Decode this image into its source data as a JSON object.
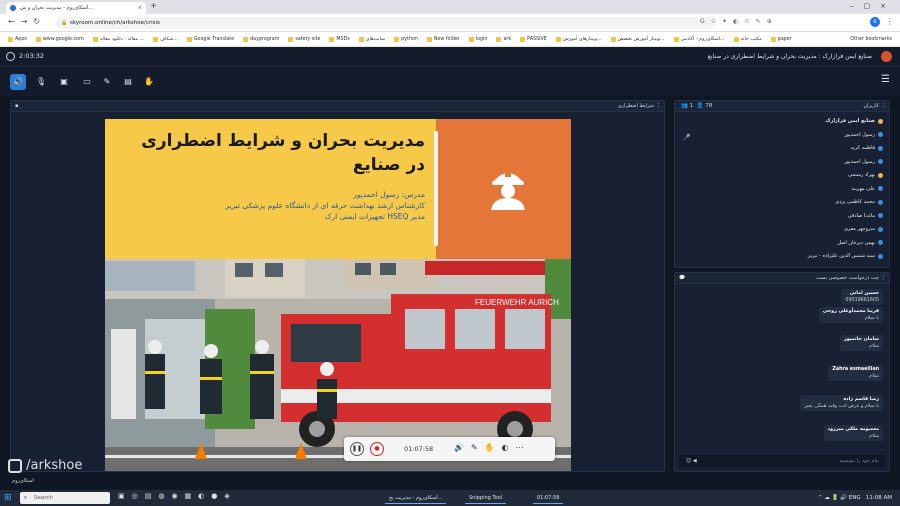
{
  "browser": {
    "tab_title": "اسکای‌روم - مدیریت بحران و ش...",
    "url": "skyroom.online/ch/arkshoe/crisis",
    "profile_initial": "K",
    "bookmarks": [
      "Apps",
      "www.google.com",
      "مقاله - دانلود مقاله ...",
      "شکاف...",
      "Google Translate",
      "dayprogram",
      "safety site",
      "MSDs",
      "سایت‌های",
      "python",
      "New folder",
      "login",
      "ark",
      "PASSIVE",
      "وبینارهای آموزش...",
      "وبینار آموزش تخصص...",
      "اسکای‌روم - آکادمی...",
      "مکتب خانه",
      "paper"
    ],
    "other_bookmarks": "Other bookmarks"
  },
  "app": {
    "timer": "2:03:32",
    "title": "صنایع ایمن فرازارک : مدیریت بحران و شرایط اضطراری در صنایع"
  },
  "stage": {
    "header": "شرایط اضطراری",
    "slide_title": "مدیریت بحران و شرایط اضطراری در صنایع",
    "slide_lines": [
      "مدرس: رسول احمدپور",
      "کارشناس ارشد بهداشت حرفه ای از دانشگاه علوم پزشکی تبریز",
      "مدیر HSEQ تجهیزات ایمنی ارک"
    ],
    "truck_text": "FEUERWEHR AURICH",
    "player_time": "01:07:58"
  },
  "watermark": {
    "brand": "/arkshoe",
    "sub": "اسکای‌روم"
  },
  "users": {
    "header": "کاربران",
    "count_a": "1",
    "count_b": "78",
    "list": [
      {
        "name": "صنایع ایمن فرازارک",
        "host": true
      },
      {
        "name": "رسول احمدپور",
        "host": false
      },
      {
        "name": "فاطمه کریه",
        "host": false
      },
      {
        "name": "رسول احمدپور",
        "host": false
      },
      {
        "name": "بهزاد رستمی",
        "host": true
      },
      {
        "name": "علی مهربند",
        "host": false
      },
      {
        "name": "محمد کاظمی یزدی",
        "host": false
      },
      {
        "name": "مائدنا صادقی",
        "host": false
      },
      {
        "name": "سروچهر مقری",
        "host": false
      },
      {
        "name": "بهمن دیرجان اصل",
        "host": false
      },
      {
        "name": "سید شمس الدین علیزاده - تبریز",
        "host": false
      }
    ]
  },
  "chat": {
    "header": "چت درخواست خصوصی بست",
    "messages": [
      {
        "name": "حسین امانی",
        "body": "09019661605"
      },
      {
        "name": "فریبا محمدآوغلی روحی",
        "body": "با سلام"
      },
      {
        "name": "سامان حاتمپور",
        "body": "سلام"
      },
      {
        "name": "Zahra esmaeilian",
        "body": "سلام"
      },
      {
        "name": "رضا قاسم زاده",
        "body": "با سلام و عرض ادب وقت همگی بخیر"
      },
      {
        "name": "معصومه ملکی میرزود",
        "body": "سلام"
      }
    ],
    "input_placeholder": "پیام خود را بنویسید"
  },
  "taskbar": {
    "search_placeholder": "Search",
    "tasks": [
      "اسکای‌روم - مدیریت بح...",
      "Snipping Tool",
      "01:07:58"
    ],
    "lang": "ENG",
    "time": "11:08 AM"
  },
  "colors": {
    "accent": "#2b7fd4",
    "slide_yellow": "#f7c948",
    "slide_orange": "#e4763a",
    "record_red": "#c62828"
  }
}
